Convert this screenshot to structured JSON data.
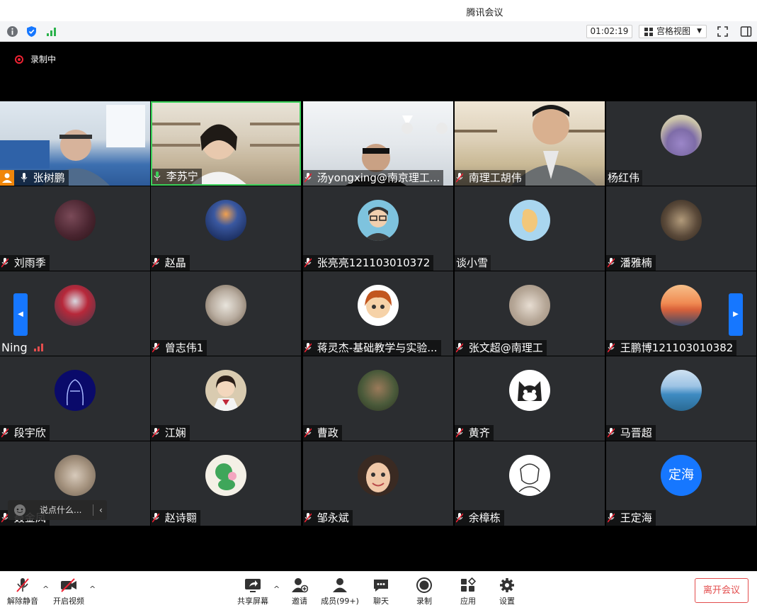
{
  "window": {
    "title": "腾讯会议"
  },
  "topbar": {
    "timer": "01:02:19",
    "view_label": "宫格视图"
  },
  "recording": {
    "label": "录制中"
  },
  "participants": [
    {
      "name": "张树鹏",
      "muted": false
    },
    {
      "name": "李苏宁",
      "muted": false
    },
    {
      "name": "汤yongxing@南京理工...",
      "muted": true
    },
    {
      "name": "南理工胡伟",
      "muted": true
    },
    {
      "name": "杨红伟",
      "muted": false
    },
    {
      "name": "刘雨季",
      "muted": true
    },
    {
      "name": "赵晶",
      "muted": true
    },
    {
      "name": "张亮亮121103010372",
      "muted": true
    },
    {
      "name": "谈小雪",
      "muted": false
    },
    {
      "name": "潘雅楠",
      "muted": true
    },
    {
      "name": "Ning",
      "muted": false
    },
    {
      "name": "曾志伟1",
      "muted": true
    },
    {
      "name": "蒋灵杰-基础教学与实验...",
      "muted": true
    },
    {
      "name": "张文超@南理工",
      "muted": true
    },
    {
      "name": "王鹏博121103010382",
      "muted": true
    },
    {
      "name": "段宇欣",
      "muted": true
    },
    {
      "name": "江娴",
      "muted": true
    },
    {
      "name": "曹政",
      "muted": true
    },
    {
      "name": "黄齐",
      "muted": true
    },
    {
      "name": "马晋超",
      "muted": true
    },
    {
      "name": "聂金凤",
      "muted": true
    },
    {
      "name": "赵诗翾",
      "muted": true
    },
    {
      "name": "邹永斌",
      "muted": true
    },
    {
      "name": "余樟栋",
      "muted": true
    },
    {
      "name": "王定海",
      "muted": true
    }
  ],
  "avatar_text": {
    "wang_dinghai": "定海"
  },
  "chat_pill": {
    "placeholder": "说点什么..."
  },
  "toolbar": {
    "unmute": "解除静音",
    "start_video": "开启视频",
    "share_screen": "共享屏幕",
    "invite": "邀请",
    "members": "成员(99+)",
    "chat": "聊天",
    "record": "录制",
    "apps": "应用",
    "settings": "设置",
    "leave": "离开会议"
  },
  "colors": {
    "accent": "#1677ff",
    "leave": "#e34d4d",
    "active_speaker": "#3bd15a",
    "tile_bg": "#2b2d30"
  }
}
